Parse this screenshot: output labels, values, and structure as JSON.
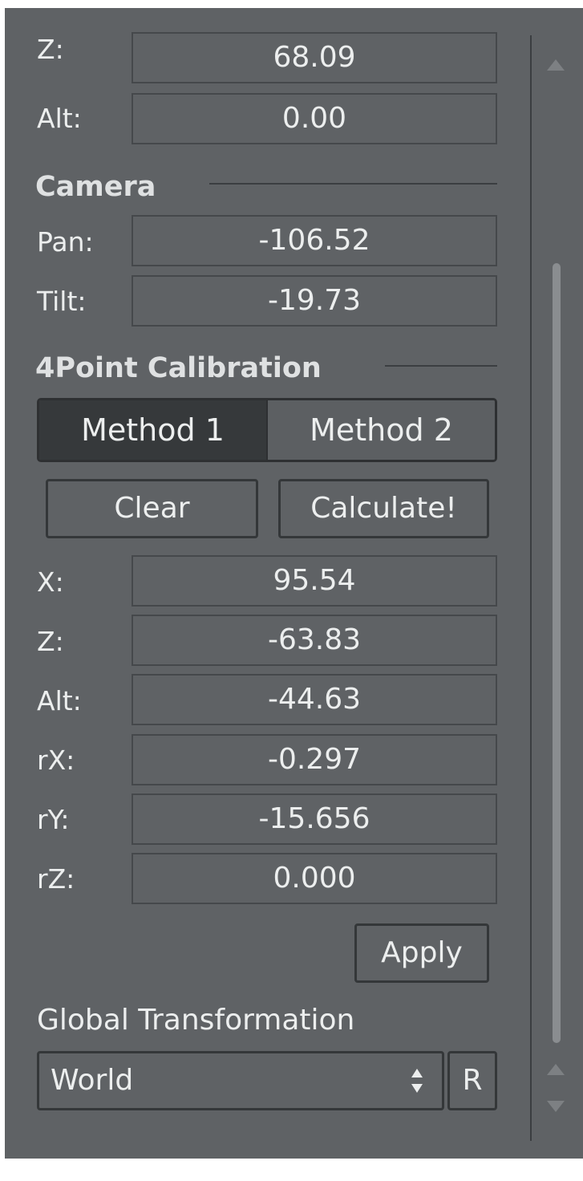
{
  "position": {
    "z": {
      "label": "Z:",
      "value": "68.09"
    },
    "alt": {
      "label": "Alt:",
      "value": "0.00"
    }
  },
  "camera": {
    "header": "Camera",
    "pan": {
      "label": "Pan:",
      "value": "-106.52"
    },
    "tilt": {
      "label": "Tilt:",
      "value": "-19.73"
    }
  },
  "calibration": {
    "header": "4Point Calibration",
    "method_tabs": [
      "Method 1",
      "Method 2"
    ],
    "active_method": "Method 1",
    "clear_label": "Clear",
    "calculate_label": "Calculate!",
    "fields": [
      {
        "label": "X:",
        "value": "95.54"
      },
      {
        "label": "Z:",
        "value": "-63.83"
      },
      {
        "label": "Alt:",
        "value": "-44.63"
      },
      {
        "label": "rX:",
        "value": "-0.297"
      },
      {
        "label": "rY:",
        "value": "-15.656"
      },
      {
        "label": "rZ:",
        "value": "0.000"
      }
    ],
    "apply_label": "Apply"
  },
  "global_transformation": {
    "label": "Global Transformation",
    "selected": "World",
    "reset_label": "R"
  },
  "icons": {
    "combo_arrows": "up-down-arrows-icon",
    "scroll_up": "triangle-up-icon",
    "scroll_down": "triangle-down-icon"
  },
  "colors": {
    "panel_bg": "#5f6265",
    "field_border": "#45484b",
    "active_tab": "#36393b",
    "text": "#eceeee"
  }
}
